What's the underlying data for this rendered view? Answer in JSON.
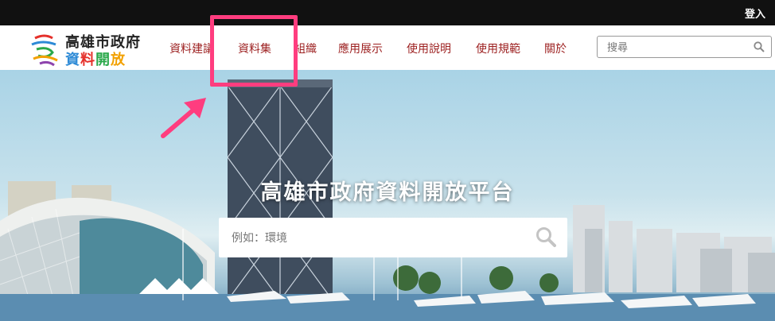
{
  "topbar": {
    "login_label": "登入"
  },
  "logo": {
    "line1": "高雄市政府",
    "line2_chars": [
      "資",
      "料",
      "開",
      "放"
    ],
    "line2_colors": [
      "#2d8ad6",
      "#e5302a",
      "#2aa84a",
      "#f2a100"
    ]
  },
  "nav": {
    "items": [
      "資料建議",
      "資料集",
      "組織",
      "應用展示",
      "使用說明",
      "使用規範",
      "關於"
    ]
  },
  "search": {
    "placeholder": "搜尋"
  },
  "hero": {
    "title": "高雄市政府資料開放平台",
    "search_placeholder": "例如：環境"
  },
  "colors": {
    "nav_text": "#9c1f1f",
    "highlight": "#ff3d7f",
    "topbar": "#111111"
  }
}
